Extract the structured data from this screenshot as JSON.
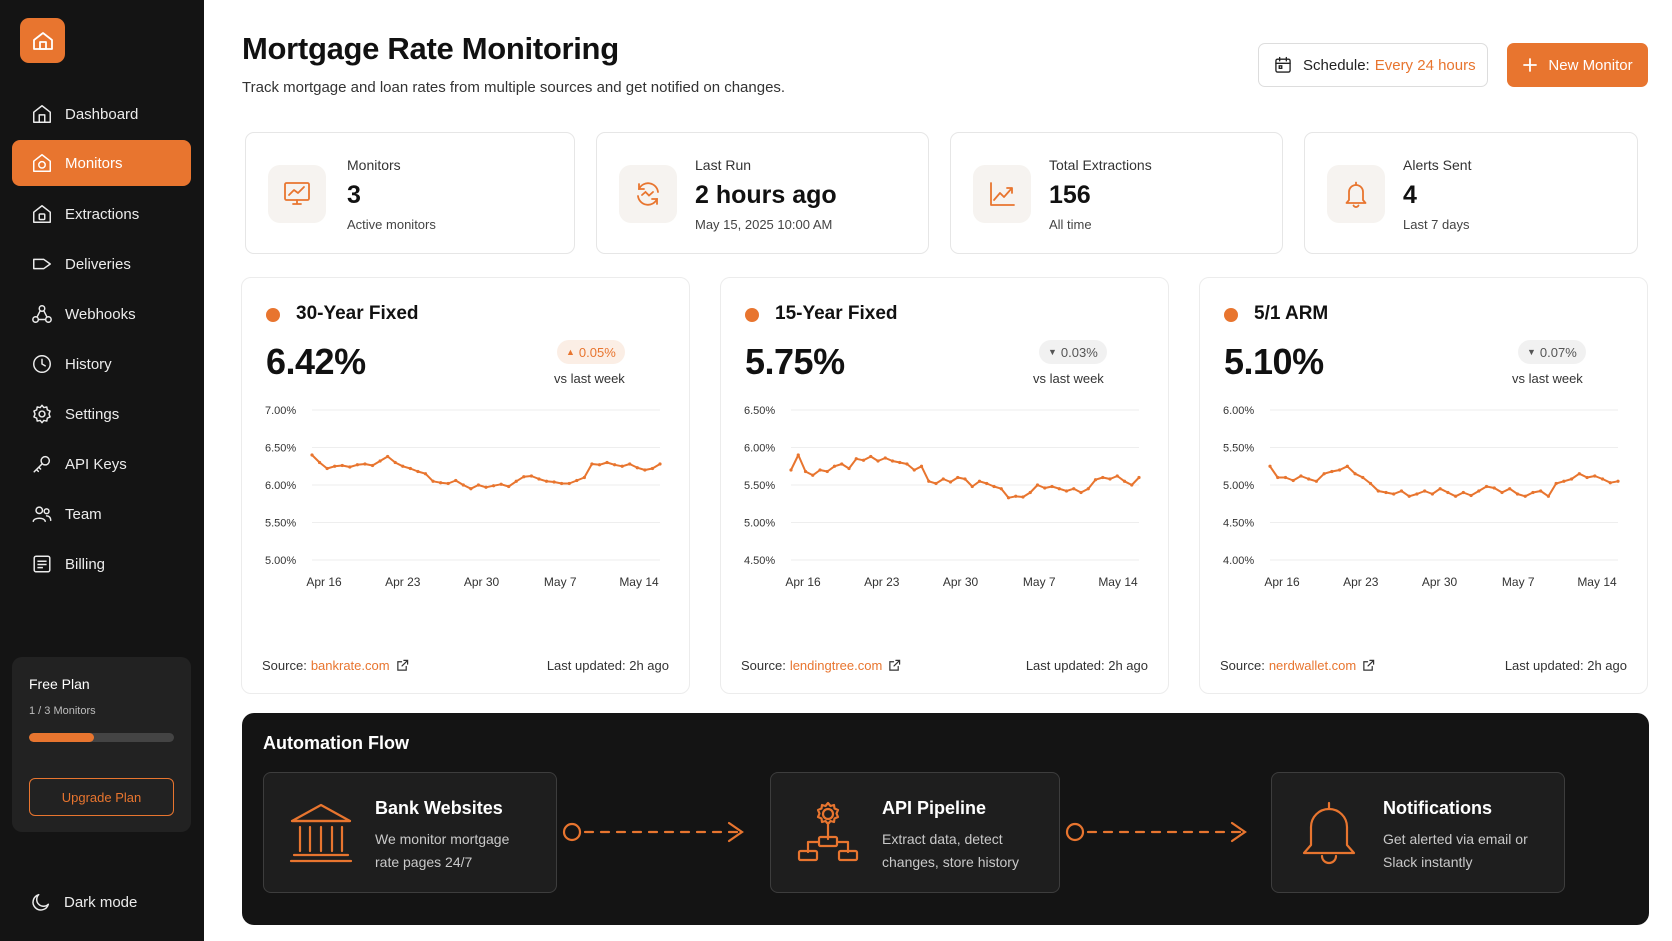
{
  "sidebar": {
    "items": [
      {
        "label": "Dashboard",
        "icon": "home-icon"
      },
      {
        "label": "Monitors",
        "icon": "monitor-icon",
        "active": true
      },
      {
        "label": "Extractions",
        "icon": "extraction-icon"
      },
      {
        "label": "Deliveries",
        "icon": "delivery-icon"
      },
      {
        "label": "Webhooks",
        "icon": "webhook-icon"
      },
      {
        "label": "History",
        "icon": "clock-icon"
      },
      {
        "label": "Settings",
        "icon": "gear-icon"
      },
      {
        "label": "API Keys",
        "icon": "key-icon"
      },
      {
        "label": "Team",
        "icon": "team-icon"
      },
      {
        "label": "Billing",
        "icon": "billing-icon"
      }
    ],
    "plan": {
      "title": "Free Plan",
      "usage": "1 / 3 Monitors",
      "progress": 0.45,
      "upgrade_label": "Upgrade Plan"
    },
    "dark_mode_label": "Dark mode"
  },
  "header": {
    "title": "Mortgage Rate Monitoring",
    "subtitle": "Track mortgage and loan rates from multiple sources and get notified on changes.",
    "schedule_label": "Schedule:",
    "schedule_value": "Every 24 hours",
    "new_monitor_label": "New Monitor"
  },
  "stats": [
    {
      "label": "Monitors",
      "value": "3",
      "sub": "Active monitors",
      "icon": "chart-monitor-icon"
    },
    {
      "label": "Last Run",
      "value": "2 hours ago",
      "sub": "May 15, 2025 10:00 AM",
      "icon": "refresh-icon"
    },
    {
      "label": "Total Extractions",
      "value": "156",
      "sub": "All time",
      "icon": "trend-icon"
    },
    {
      "label": "Alerts Sent",
      "value": "4",
      "sub": "Last 7 days",
      "icon": "bell-icon"
    }
  ],
  "rates": [
    {
      "title": "30-Year Fixed",
      "value": "6.42%",
      "change": "0.05%",
      "direction": "up",
      "change_label": "vs last week",
      "source_label": "Source:",
      "source": "bankrate.com",
      "updated": "Last updated: 2h ago"
    },
    {
      "title": "15-Year Fixed",
      "value": "5.75%",
      "change": "0.03%",
      "direction": "down",
      "change_label": "vs last week",
      "source_label": "Source:",
      "source": "lendingtree.com",
      "updated": "Last updated: 2h ago"
    },
    {
      "title": "5/1 ARM",
      "value": "5.10%",
      "change": "0.07%",
      "direction": "down",
      "change_label": "vs last week",
      "source_label": "Source:",
      "source": "nerdwallet.com",
      "updated": "Last updated: 2h ago"
    }
  ],
  "chart_data": [
    {
      "type": "line",
      "x_ticks": [
        "Apr 16",
        "Apr 23",
        "Apr 30",
        "May 7",
        "May 14"
      ],
      "y_ticks": [
        "7.00%",
        "6.50%",
        "6.00%",
        "5.50%",
        "5.00%"
      ],
      "ylim": [
        5.0,
        7.0
      ],
      "grid": true,
      "color": "#e8752f",
      "values": [
        6.4,
        6.3,
        6.22,
        6.25,
        6.26,
        6.24,
        6.27,
        6.28,
        6.26,
        6.32,
        6.38,
        6.3,
        6.25,
        6.22,
        6.18,
        6.15,
        6.05,
        6.03,
        6.02,
        6.06,
        6.0,
        5.95,
        6.0,
        5.97,
        5.99,
        6.01,
        5.98,
        6.05,
        6.11,
        6.12,
        6.08,
        6.05,
        6.04,
        6.02,
        6.02,
        6.06,
        6.1,
        6.28,
        6.27,
        6.3,
        6.27,
        6.25,
        6.28,
        6.23,
        6.2,
        6.22,
        6.28
      ]
    },
    {
      "type": "line",
      "x_ticks": [
        "Apr 16",
        "Apr 23",
        "Apr 30",
        "May 7",
        "May 14"
      ],
      "y_ticks": [
        "6.50%",
        "6.00%",
        "5.50%",
        "5.00%",
        "4.50%"
      ],
      "ylim": [
        4.5,
        6.5
      ],
      "grid": true,
      "color": "#e8752f",
      "values": [
        5.7,
        5.9,
        5.68,
        5.63,
        5.7,
        5.68,
        5.75,
        5.78,
        5.72,
        5.85,
        5.83,
        5.88,
        5.82,
        5.86,
        5.82,
        5.8,
        5.78,
        5.7,
        5.75,
        5.55,
        5.52,
        5.58,
        5.54,
        5.6,
        5.58,
        5.48,
        5.55,
        5.52,
        5.48,
        5.45,
        5.33,
        5.35,
        5.34,
        5.4,
        5.5,
        5.46,
        5.48,
        5.45,
        5.42,
        5.45,
        5.4,
        5.45,
        5.57,
        5.6,
        5.58,
        5.62,
        5.55,
        5.5,
        5.6
      ]
    },
    {
      "type": "line",
      "x_ticks": [
        "Apr 16",
        "Apr 23",
        "Apr 30",
        "May 7",
        "May 14"
      ],
      "y_ticks": [
        "6.00%",
        "5.50%",
        "5.00%",
        "4.50%",
        "4.00%"
      ],
      "ylim": [
        4.0,
        6.0
      ],
      "grid": true,
      "color": "#e8752f",
      "values": [
        5.25,
        5.1,
        5.1,
        5.06,
        5.12,
        5.08,
        5.05,
        5.15,
        5.18,
        5.2,
        5.25,
        5.15,
        5.1,
        5.02,
        4.92,
        4.9,
        4.88,
        4.92,
        4.85,
        4.88,
        4.92,
        4.88,
        4.95,
        4.9,
        4.85,
        4.9,
        4.86,
        4.92,
        4.98,
        4.96,
        4.9,
        4.95,
        4.88,
        4.85,
        4.9,
        4.92,
        4.85,
        5.02,
        5.05,
        5.08,
        5.15,
        5.1,
        5.12,
        5.08,
        5.03,
        5.05
      ]
    }
  ],
  "automation": {
    "title": "Automation Flow",
    "steps": [
      {
        "title": "Bank Websites",
        "desc": "We monitor mortgage rate pages 24/7",
        "icon": "bank-icon"
      },
      {
        "title": "API Pipeline",
        "desc": "Extract data, detect changes, store history",
        "icon": "pipeline-icon"
      },
      {
        "title": "Notifications",
        "desc": "Get alerted via email or Slack instantly",
        "icon": "bell-icon"
      }
    ]
  }
}
